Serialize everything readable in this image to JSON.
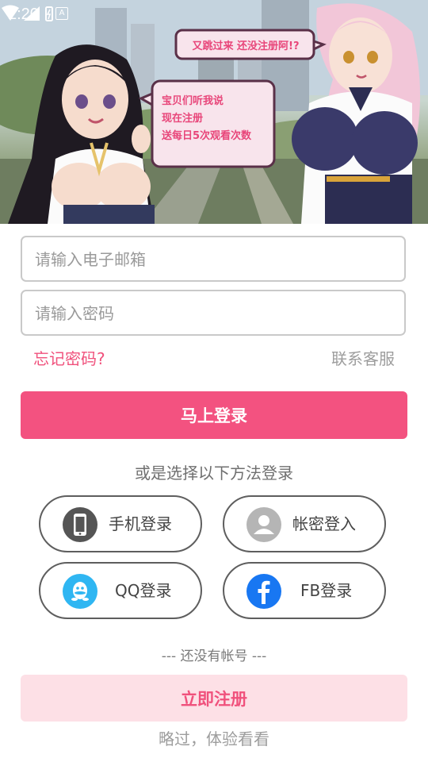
{
  "status_bar": {
    "time": "2:20",
    "notification_icon": "A"
  },
  "banner": {
    "bubble_top": "又跳过来 还没注册阿!?",
    "bubble_left_line1": "宝贝们听我说",
    "bubble_left_line2": "现在注册",
    "bubble_left_line3": "送每日5次观看次数"
  },
  "form": {
    "email_placeholder": "请输入电子邮箱",
    "password_placeholder": "请输入密码",
    "forgot_password": "忘记密码?",
    "contact_support": "联系客服",
    "login_button": "马上登录"
  },
  "alternatives": {
    "label": "或是选择以下方法登录",
    "methods": [
      {
        "label": "手机登录",
        "icon": "phone-icon",
        "color": "#555555"
      },
      {
        "label": "帐密登入",
        "icon": "user-icon",
        "color": "#b5b5b5"
      },
      {
        "label": "QQ登录",
        "icon": "qq-icon",
        "color": "#2fb6f2"
      },
      {
        "label": "FB登录",
        "icon": "facebook-icon",
        "color": "#1877f2"
      }
    ]
  },
  "footer": {
    "no_account": "--- 还没有帐号 ---",
    "register_button": "立即注册",
    "skip": "略过，体验看看"
  },
  "colors": {
    "accent": "#f35280",
    "accent_light": "#fde0e6",
    "link": "#f0517c"
  }
}
